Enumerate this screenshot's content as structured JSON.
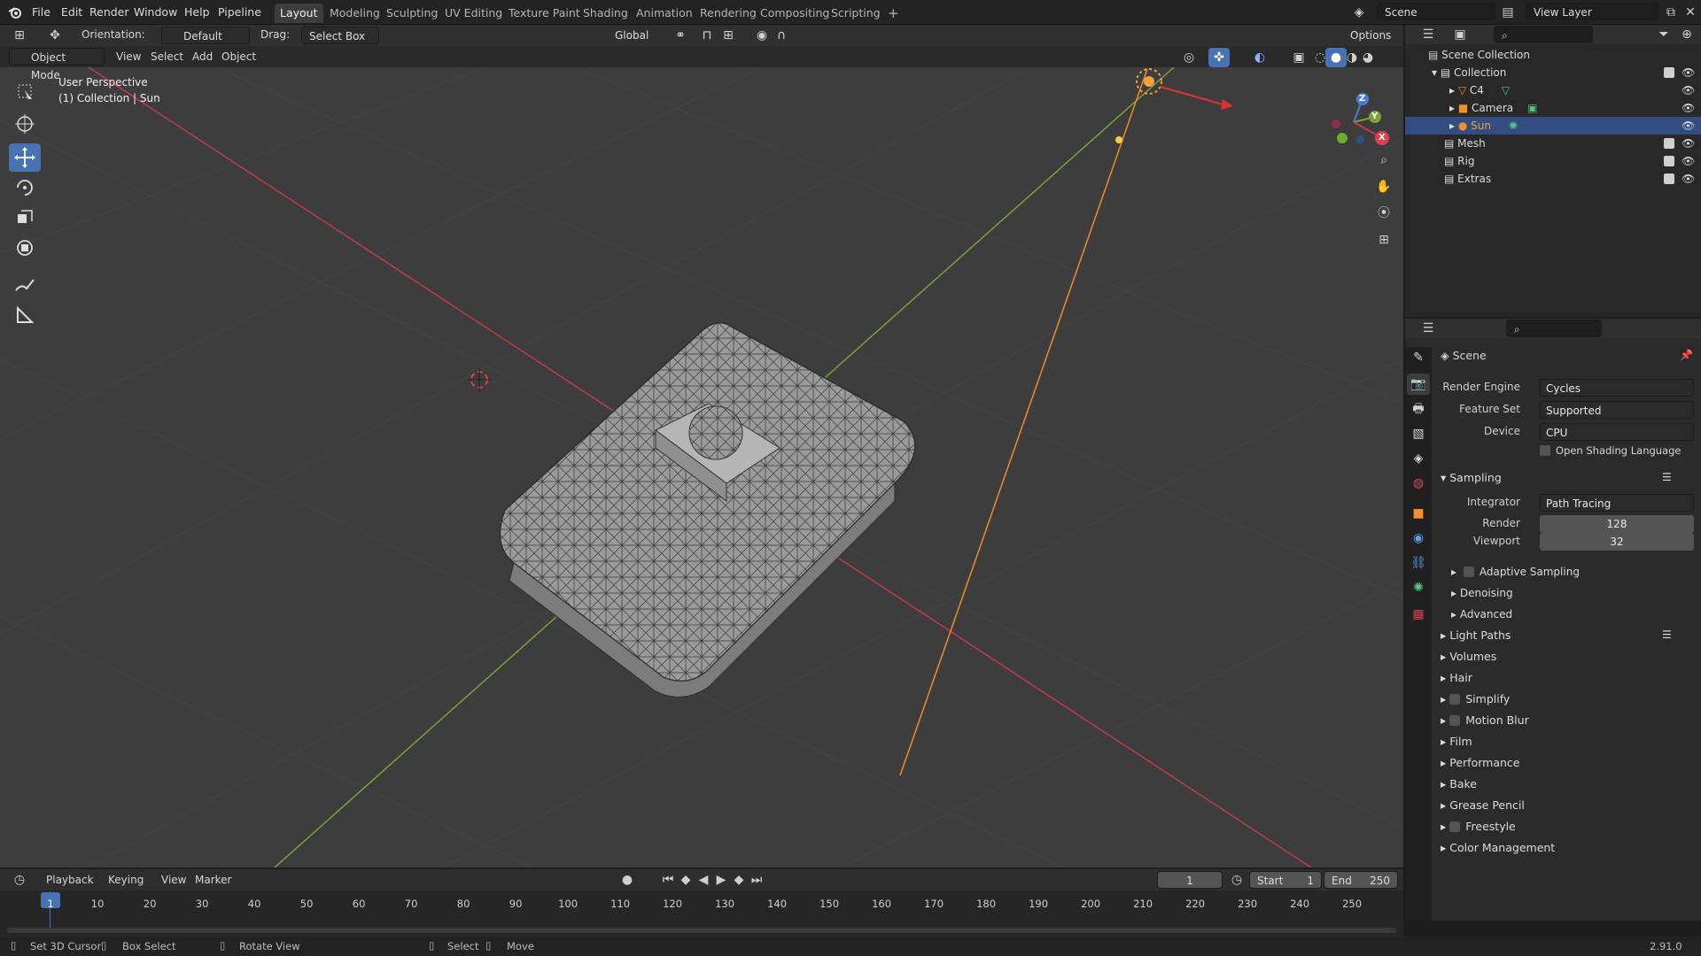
{
  "menus": [
    "File",
    "Edit",
    "Render",
    "Window",
    "Help",
    "Pipeline"
  ],
  "workspaces": [
    "Layout",
    "Modeling",
    "Sculpting",
    "UV Editing",
    "Texture Paint",
    "Shading",
    "Animation",
    "Rendering",
    "Compositing",
    "Scripting"
  ],
  "active_workspace": "Layout",
  "scene_field": "Scene",
  "view_layer_field": "View Layer",
  "tool_header": {
    "orientation_label": "Orientation:",
    "orientation_value": "Default",
    "drag_label": "Drag:",
    "drag_value": "Select Box",
    "transform_orientation": "Global",
    "options": "Options"
  },
  "viewport_header": {
    "mode": "Object Mode",
    "view": "View",
    "select": "Select",
    "add": "Add",
    "object": "Object"
  },
  "viewport_info": {
    "perspective": "User Perspective",
    "context": "(1) Collection | Sun"
  },
  "gizmo": {
    "x": "X",
    "y": "Y",
    "z": "Z"
  },
  "outliner": {
    "root": "Scene Collection",
    "collection": "Collection",
    "items": [
      "C4",
      "Camera",
      "Sun"
    ],
    "selected": "Sun",
    "others": [
      "Mesh",
      "Rig",
      "Extras"
    ]
  },
  "properties": {
    "context": "Scene",
    "render_engine_label": "Render Engine",
    "render_engine": "Cycles",
    "feature_set_label": "Feature Set",
    "feature_set": "Supported",
    "device_label": "Device",
    "device": "CPU",
    "osl": "Open Shading Language",
    "sampling": "Sampling",
    "integrator_label": "Integrator",
    "integrator": "Path Tracing",
    "render_label": "Render",
    "render_samples": "128",
    "viewport_label": "Viewport",
    "viewport_samples": "32",
    "subsections": [
      "Adaptive Sampling",
      "Denoising",
      "Advanced"
    ],
    "panels": [
      "Light Paths",
      "Volumes",
      "Hair",
      "Simplify",
      "Motion Blur",
      "Film",
      "Performance",
      "Bake",
      "Grease Pencil",
      "Freestyle",
      "Color Management"
    ]
  },
  "timeline": {
    "playback": "Playback",
    "keying": "Keying",
    "view": "View",
    "marker": "Marker",
    "current_frame": "1",
    "start_label": "Start",
    "start": "1",
    "end_label": "End",
    "end": "250",
    "ticks": [
      "1",
      "10",
      "20",
      "30",
      "40",
      "50",
      "60",
      "70",
      "80",
      "90",
      "100",
      "110",
      "120",
      "130",
      "140",
      "150",
      "160",
      "170",
      "180",
      "190",
      "200",
      "210",
      "220",
      "230",
      "240",
      "250"
    ]
  },
  "status_bar": {
    "set_cursor": "Set 3D Cursor",
    "box_select": "Box Select",
    "rotate_view": "Rotate View",
    "select": "Select",
    "move": "Move",
    "version": "2.91.0"
  },
  "colors": {
    "accent": "#4772b3",
    "axis_x": "#c2394a",
    "axis_y": "#7da03a",
    "light_line": "#f08c28",
    "selected_row": "#334d80"
  }
}
